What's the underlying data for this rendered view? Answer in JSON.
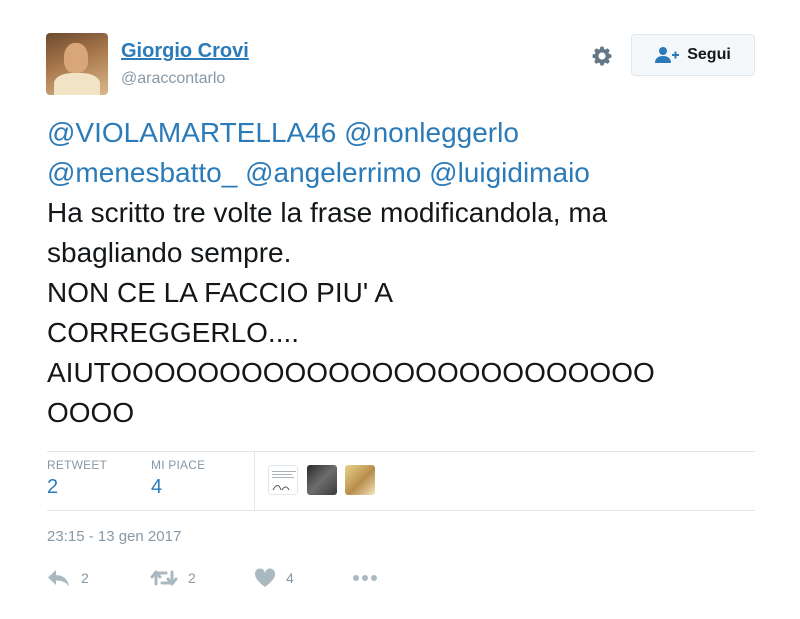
{
  "author": {
    "name": "Giorgio Crovi",
    "handle": "@araccontarlo"
  },
  "header": {
    "follow_label": "Segui"
  },
  "tweet": {
    "mentions": [
      "@VIOLAMARTELLA46",
      "@nonleggerlo",
      "@menesbatto_",
      "@angelerrimo",
      "@luigidimaio"
    ],
    "lines": [
      "Ha scritto tre volte la frase modificandola, ma",
      "sbagliando sempre.",
      "NON CE LA FACCIO PIU' A",
      "CORREGGERLO....",
      "AIUTOOOOOOOOOOOOOOOOOOOOOOOOO",
      "OOOO"
    ]
  },
  "stats": {
    "retweets_label": "RETWEET",
    "retweets_value": "2",
    "likes_label": "MI PIACE",
    "likes_value": "4"
  },
  "timestamp": "23:15 - 13 gen 2017",
  "actions": {
    "reply_count": "2",
    "retweet_count": "2",
    "like_count": "4"
  },
  "colors": {
    "link": "#2b7bb9",
    "muted": "#8899a6",
    "text": "#14171a",
    "border": "#e1e8ed"
  },
  "icons": [
    "gear-icon",
    "follow-user-icon",
    "reply-icon",
    "retweet-icon",
    "heart-icon",
    "more-icon"
  ]
}
